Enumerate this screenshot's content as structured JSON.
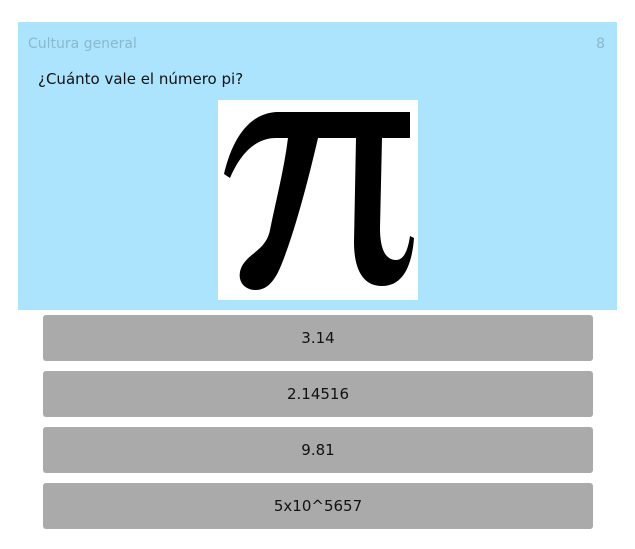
{
  "header": {
    "category": "Cultura general",
    "question_number": "8"
  },
  "question": {
    "text": "¿Cuánto vale el número pi?",
    "image_icon": "pi-symbol"
  },
  "answers": [
    {
      "label": "3.14"
    },
    {
      "label": "2.14516"
    },
    {
      "label": "9.81"
    },
    {
      "label": "5x10^5657"
    }
  ],
  "colors": {
    "card_background": "#ade4fd",
    "header_text": "#8ab8cc",
    "answer_background": "#aaaaaa"
  }
}
